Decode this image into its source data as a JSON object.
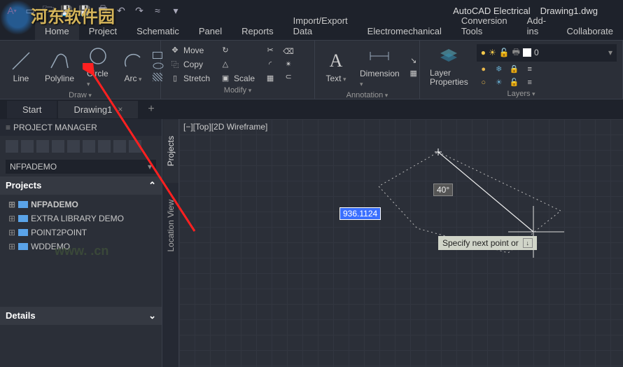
{
  "app": {
    "product": "AutoCAD Electrical",
    "docname": "Drawing1.dwg"
  },
  "ribbon_tabs": [
    "Home",
    "Project",
    "Schematic",
    "Panel",
    "Reports",
    "Import/Export Data",
    "Electromechanical",
    "Conversion Tools",
    "Add-ins",
    "Collaborate"
  ],
  "ribbon_active_tab": 0,
  "panels": {
    "draw": {
      "title": "Draw",
      "line": "Line",
      "polyline": "Polyline",
      "circle": "Circle",
      "arc": "Arc"
    },
    "modify": {
      "title": "Modify",
      "move": "Move",
      "copy": "Copy",
      "stretch": "Stretch",
      "rotate_icon": "↻",
      "mirror_icon": "⇲",
      "scale": "Scale"
    },
    "annotation": {
      "title": "Annotation",
      "text": "Text",
      "dimension": "Dimension"
    },
    "layers": {
      "title": "Layers",
      "properties": "Layer\nProperties",
      "combo_value": "0"
    }
  },
  "doc_tabs": {
    "start": "Start",
    "drawing": "Drawing1"
  },
  "project_manager": {
    "title": "PROJECT MANAGER",
    "combo": "NFPADEMO",
    "projects_label": "Projects",
    "tree": [
      "NFPADEMO",
      "EXTRA LIBRARY DEMO",
      "POINT2POINT",
      "WDDEMO"
    ],
    "details_label": "Details"
  },
  "side_tabs": {
    "projects": "Projects",
    "location": "Location View"
  },
  "canvas": {
    "viewport": "[−][Top][2D Wireframe]",
    "dim_value": "936.1124",
    "angle_value": "40°",
    "tooltip": "Specify next point or"
  },
  "watermark": {
    "chinese": "河东软件园",
    "url": "www.         .cn"
  }
}
